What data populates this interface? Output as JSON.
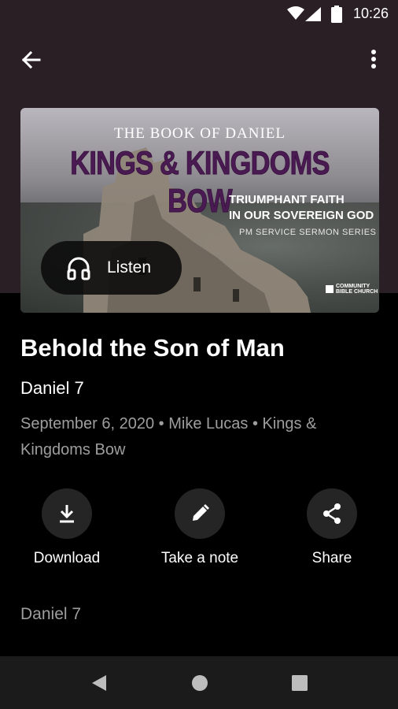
{
  "status_bar": {
    "time": "10:26"
  },
  "artwork": {
    "kicker": "THE BOOK OF DANIEL",
    "title": "KINGS & KINGDOMS BOW",
    "subtitle_line1": "TRIUMPHANT FAITH",
    "subtitle_line2": "IN OUR SOVEREIGN GOD",
    "series_line": "PM SERVICE SERMON SERIES",
    "logo_line1": "COMMUNITY",
    "logo_line2": "BIBLE CHURCH"
  },
  "listen_button": {
    "label": "Listen"
  },
  "sermon": {
    "title": "Behold the Son of Man",
    "scripture": "Daniel 7",
    "meta": "September 6, 2020 • Mike Lucas • Kings & Kingdoms Bow"
  },
  "actions": {
    "download": "Download",
    "note": "Take a note",
    "share": "Share"
  },
  "section": {
    "label": "Daniel 7"
  },
  "colors": {
    "header_background": "#2a1f25",
    "page_background": "#000000",
    "muted_text": "#9e9e9e",
    "action_circle": "#252525",
    "artwork_title": "#4a1a52",
    "nav_bar": "#1b1b1b"
  },
  "icons": {
    "back": "arrow-left-icon",
    "more": "more-vertical-icon",
    "listen": "headphones-icon",
    "download": "download-icon",
    "note": "pencil-icon",
    "share": "share-icon",
    "nav_back": "triangle-back-icon",
    "nav_home": "circle-home-icon",
    "nav_recent": "square-recents-icon"
  }
}
